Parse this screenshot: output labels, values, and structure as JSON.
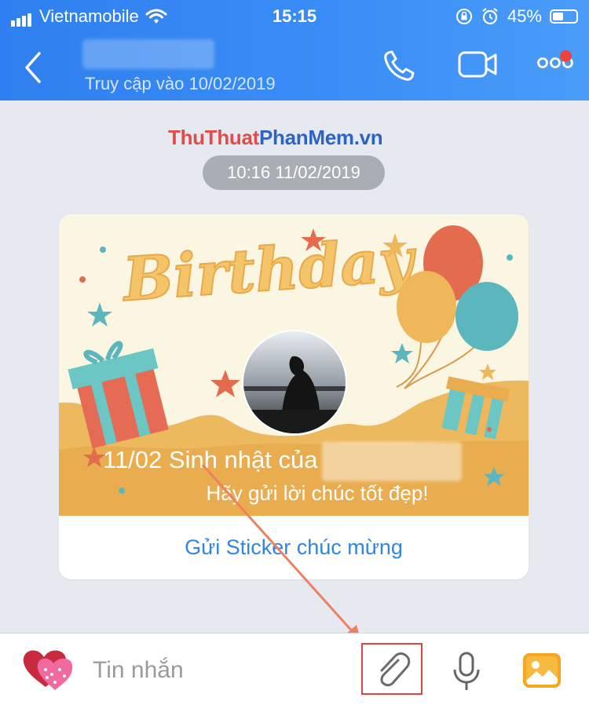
{
  "status_bar": {
    "carrier": "Vietnamobile",
    "time": "15:15",
    "battery": "45%",
    "battery_level": 0.45
  },
  "header": {
    "last_seen": "Truy cập vào 10/02/2019"
  },
  "chat": {
    "watermark_part1": "ThuThuat",
    "watermark_part2": "PhanMem.vn",
    "timestamp": "10:16 11/02/2019",
    "card": {
      "title_art": "Birthday",
      "birthday_text": "11/02 Sinh nhật của",
      "prompt": "Hãy gửi lời chúc tốt đẹp!",
      "action": "Gửi Sticker chúc mừng"
    }
  },
  "composer": {
    "placeholder": "Tin nhắn"
  },
  "icons": [
    "signal-icon",
    "wifi-icon",
    "rotation-lock-icon",
    "alarm-icon",
    "battery-icon",
    "back-icon",
    "phone-icon",
    "video-call-icon",
    "more-icon",
    "sticker-icon",
    "paperclip-icon",
    "microphone-icon",
    "photo-icon"
  ],
  "colors": {
    "header": "#3b8ef6",
    "link": "#2f86e0",
    "highlight": "#e04545",
    "notification": "#f0433f"
  }
}
